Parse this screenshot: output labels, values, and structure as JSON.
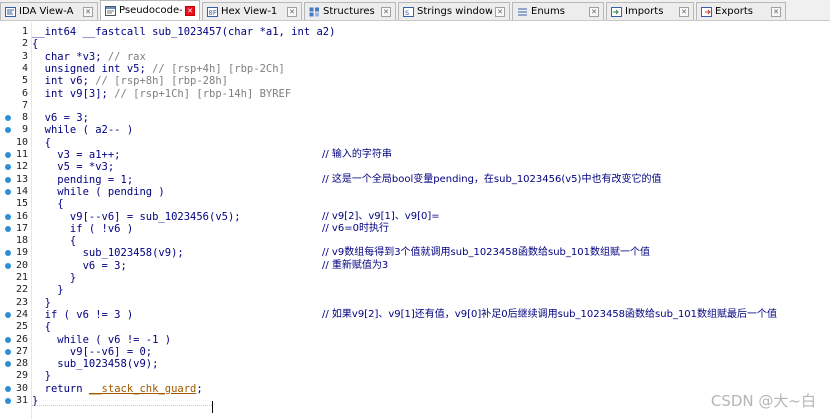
{
  "tabs": [
    {
      "label": "IDA View-A",
      "icon": "disassembly-icon",
      "active": false
    },
    {
      "label": "Pseudocode-A",
      "icon": "pseudocode-icon",
      "active": true
    },
    {
      "label": "Hex View-1",
      "icon": "hex-icon",
      "active": false
    },
    {
      "label": "Structures",
      "icon": "structures-icon",
      "active": false
    },
    {
      "label": "Strings window",
      "icon": "strings-icon",
      "active": false
    },
    {
      "label": "Enums",
      "icon": "enums-icon",
      "active": false
    },
    {
      "label": "Imports",
      "icon": "imports-icon",
      "active": false
    },
    {
      "label": "Exports",
      "icon": "exports-icon",
      "active": false
    }
  ],
  "code_lines": [
    {
      "n": "1",
      "bp": false,
      "code": "__int64 __fastcall sub_1023457(char *a1, int a2)",
      "comment": ""
    },
    {
      "n": "2",
      "bp": false,
      "code": "{",
      "comment": ""
    },
    {
      "n": "3",
      "bp": false,
      "code": "  char *v3; // rax",
      "comment": ""
    },
    {
      "n": "4",
      "bp": false,
      "code": "  unsigned int v5; // [rsp+4h] [rbp-2Ch]",
      "comment": ""
    },
    {
      "n": "5",
      "bp": false,
      "code": "  int v6; // [rsp+8h] [rbp-28h]",
      "comment": ""
    },
    {
      "n": "6",
      "bp": false,
      "code": "  int v9[3]; // [rsp+1Ch] [rbp-14h] BYREF",
      "comment": ""
    },
    {
      "n": "7",
      "bp": false,
      "code": "",
      "comment": ""
    },
    {
      "n": "8",
      "bp": true,
      "code": "  v6 = 3;",
      "comment": ""
    },
    {
      "n": "9",
      "bp": true,
      "code": "  while ( a2-- )",
      "comment": ""
    },
    {
      "n": "10",
      "bp": false,
      "code": "  {",
      "comment": ""
    },
    {
      "n": "11",
      "bp": true,
      "code": "    v3 = a1++;",
      "comment": "// 输入的字符串"
    },
    {
      "n": "12",
      "bp": true,
      "code": "    v5 = *v3;",
      "comment": ""
    },
    {
      "n": "13",
      "bp": true,
      "code": "    pending = 1;",
      "comment": "// 这是一个全局bool变量pending，在sub_1023456(v5)中也有改变它的值"
    },
    {
      "n": "14",
      "bp": true,
      "code": "    while ( pending )",
      "comment": ""
    },
    {
      "n": "15",
      "bp": false,
      "code": "    {",
      "comment": ""
    },
    {
      "n": "16",
      "bp": true,
      "code": "      v9[--v6] = sub_1023456(v5);",
      "comment": "// v9[2]、v9[1]、v9[0]="
    },
    {
      "n": "17",
      "bp": true,
      "code": "      if ( !v6 )",
      "comment": "// v6=0时执行"
    },
    {
      "n": "18",
      "bp": false,
      "code": "      {",
      "comment": ""
    },
    {
      "n": "19",
      "bp": true,
      "code": "        sub_1023458(v9);",
      "comment": "// v9数组每得到3个值就调用sub_1023458函数给sub_101数组赋一个值"
    },
    {
      "n": "20",
      "bp": true,
      "code": "        v6 = 3;",
      "comment": "// 重新赋值为3"
    },
    {
      "n": "21",
      "bp": false,
      "code": "      }",
      "comment": ""
    },
    {
      "n": "22",
      "bp": false,
      "code": "    }",
      "comment": ""
    },
    {
      "n": "23",
      "bp": false,
      "code": "  }",
      "comment": ""
    },
    {
      "n": "24",
      "bp": true,
      "code": "  if ( v6 != 3 )",
      "comment": "// 如果v9[2]、v9[1]还有值，v9[0]补足0后继续调用sub_1023458函数给sub_101数组赋最后一个值"
    },
    {
      "n": "25",
      "bp": false,
      "code": "  {",
      "comment": ""
    },
    {
      "n": "26",
      "bp": true,
      "code": "    while ( v6 != -1 )",
      "comment": ""
    },
    {
      "n": "27",
      "bp": true,
      "code": "      v9[--v6] = 0;",
      "comment": ""
    },
    {
      "n": "28",
      "bp": true,
      "code": "    sub_1023458(v9);",
      "comment": ""
    },
    {
      "n": "29",
      "bp": false,
      "code": "  }",
      "comment": ""
    },
    {
      "n": "30",
      "bp": true,
      "code": "  return __stack_chk_guard;",
      "comment": ""
    },
    {
      "n": "31",
      "bp": true,
      "code": "}",
      "comment": ""
    }
  ],
  "watermark": "CSDN @大~白",
  "colors": {
    "code": "#000080",
    "comment": "#000080",
    "declaration_comment": "#7f7f7f",
    "breakpoint_dot": "#2f8fd6",
    "active_tab_close": "#e81123"
  }
}
